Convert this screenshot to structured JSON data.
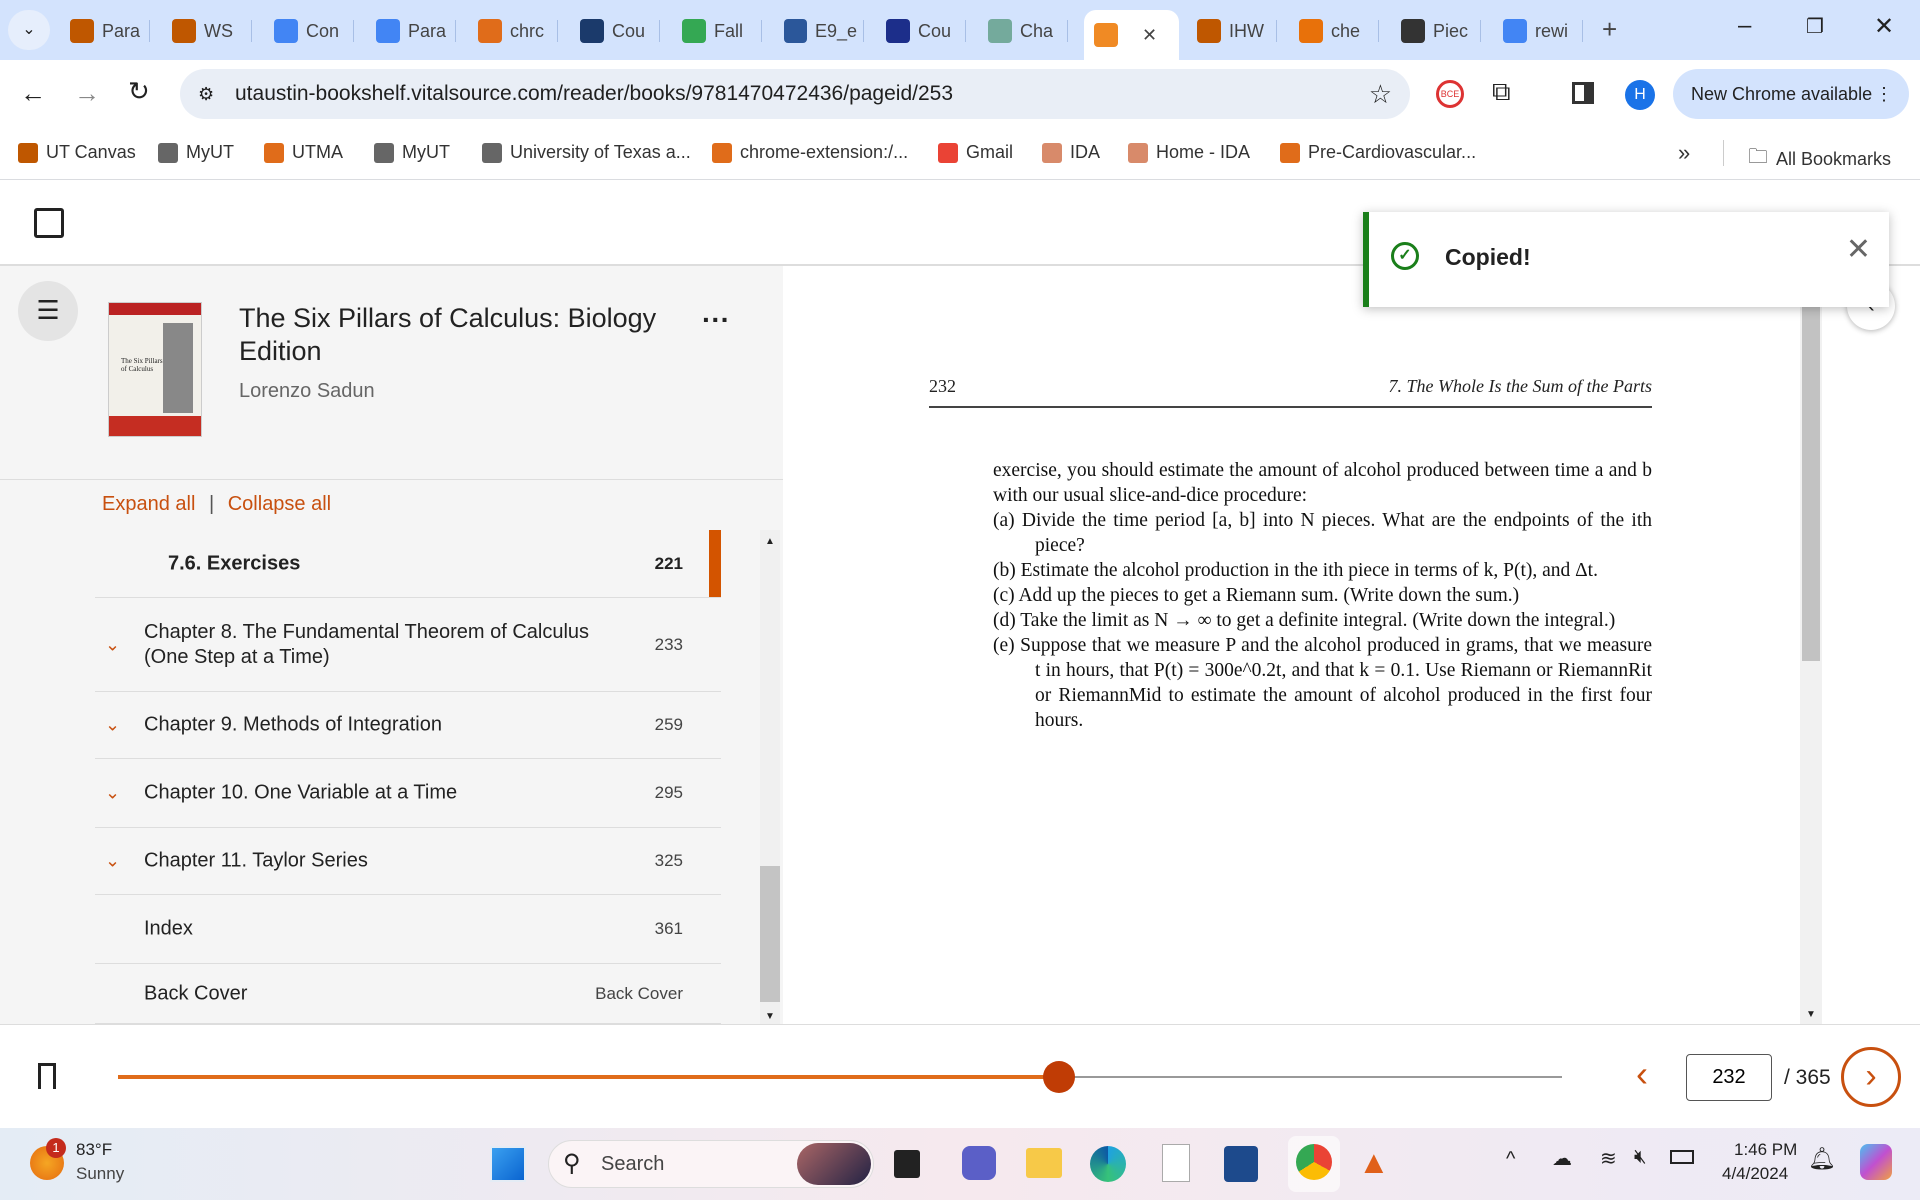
{
  "browser": {
    "tabs": [
      {
        "label": "Para",
        "color": "#bf5700"
      },
      {
        "label": "WS",
        "color": "#bf5700"
      },
      {
        "label": "Con",
        "color": "#4285f4"
      },
      {
        "label": "Para",
        "color": "#4285f4"
      },
      {
        "label": "chrc",
        "color": "#e06c1a"
      },
      {
        "label": "Cou",
        "color": "#1b3a6b"
      },
      {
        "label": "Fall",
        "color": "#34a853"
      },
      {
        "label": "E9_e",
        "color": "#2b579a"
      },
      {
        "label": "Cou",
        "color": "#1c2e8a"
      },
      {
        "label": "Cha",
        "color": "#74aa9c"
      },
      {
        "label": "",
        "color": "#f08a24",
        "active": true
      },
      {
        "label": "IHW",
        "color": "#bf5700"
      },
      {
        "label": "che",
        "color": "#e8710a"
      },
      {
        "label": "Piec",
        "color": "#333333"
      },
      {
        "label": "rewi",
        "color": "#4285f4"
      }
    ],
    "url": "utaustin-bookshelf.vitalsource.com/reader/books/9781470472436/pageid/253",
    "profile_initial": "H",
    "update_label": "New Chrome available",
    "bookmarks": [
      "UT Canvas",
      "MyUT",
      "UTMA",
      "MyUT",
      "University of Texas a...",
      "chrome-extension:/...",
      "Gmail",
      "IDA",
      "Home - IDA",
      "Pre-Cardiovascular..."
    ],
    "all_bookmarks": "All Bookmarks"
  },
  "toast": {
    "message": "Copied!"
  },
  "book": {
    "title": "The Six Pillars of Calculus: Biology Edition",
    "author": "Lorenzo Sadun",
    "cover_text": "The Six Pillars of Calculus"
  },
  "toc": {
    "expand_all": "Expand all",
    "separator": "|",
    "collapse_all": "Collapse all",
    "items": [
      {
        "label": "7.6. Exercises",
        "page": "221",
        "active": true
      },
      {
        "label": "Chapter 8. The Fundamental Theorem of Calculus (One Step at a Time)",
        "page": "233",
        "expandable": true
      },
      {
        "label": "Chapter 9. Methods of Integration",
        "page": "259",
        "expandable": true
      },
      {
        "label": "Chapter 10. One Variable at a Time",
        "page": "295",
        "expandable": true
      },
      {
        "label": "Chapter 11. Taylor Series",
        "page": "325",
        "expandable": true
      },
      {
        "label": "Index",
        "page": "361"
      },
      {
        "label": "Back Cover",
        "page": "Back Cover"
      }
    ]
  },
  "reader": {
    "page_number": "232",
    "running_head": "7. The Whole Is the Sum of the Parts",
    "intro": "exercise, you should estimate the amount of alcohol produced between time a and b with our usual slice-and-dice procedure:",
    "items": [
      "(a) Divide the time period [a, b] into N pieces. What are the endpoints of the ith piece?",
      "(b) Estimate the alcohol production in the ith piece in terms of k, P(t), and Δt.",
      "(c) Add up the pieces to get a Riemann sum. (Write down the sum.)",
      "(d) Take the limit as N → ∞ to get a definite integral. (Write down the integral.)",
      "(e) Suppose that we measure P and the alcohol produced in grams, that we measure t in hours, that P(t) = 300e^0.2t, and that k = 0.1. Use Riemann or RiemannRit or RiemannMid to estimate the amount of alcohol produced in the first four hours."
    ]
  },
  "nav": {
    "current_page": "232",
    "total": "/ 365",
    "progress": 0.652,
    "accent": "#e06c1a"
  },
  "taskbar": {
    "weather_temp": "83°F",
    "weather_desc": "Sunny",
    "weather_badge": "1",
    "search_placeholder": "Search",
    "time": "1:46 PM",
    "date": "4/4/2024"
  }
}
